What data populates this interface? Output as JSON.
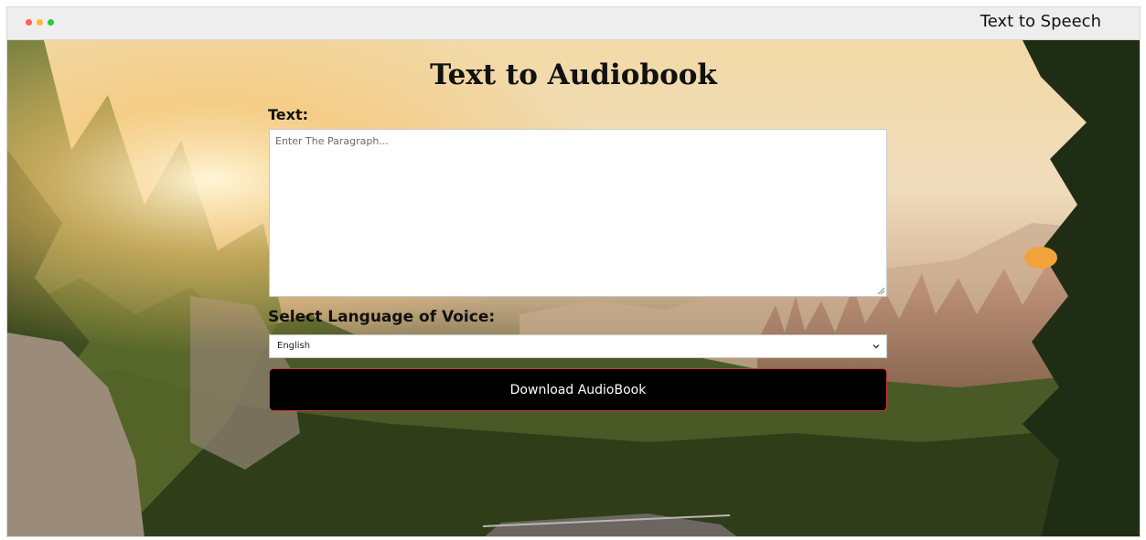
{
  "window": {
    "brand": "Text to Speech",
    "traffic_lights": [
      {
        "name": "close",
        "color": "#ff5f57"
      },
      {
        "name": "minimize",
        "color": "#febc2e"
      },
      {
        "name": "maximize",
        "color": "#28c840"
      }
    ]
  },
  "main": {
    "title": "Text to Audiobook",
    "text_label": "Text:",
    "text_placeholder": "Enter The Paragraph...",
    "text_value": "",
    "language_label": "Select Language of Voice:",
    "language_selected": "English",
    "download_label": "Download AudioBook"
  },
  "theme": {
    "button_bg": "#000000",
    "button_border": "#d23a3a",
    "title_color": "#111111"
  },
  "icons": {
    "select": "chevron-down-icon",
    "textarea_grip": "resize-grip-icon"
  }
}
